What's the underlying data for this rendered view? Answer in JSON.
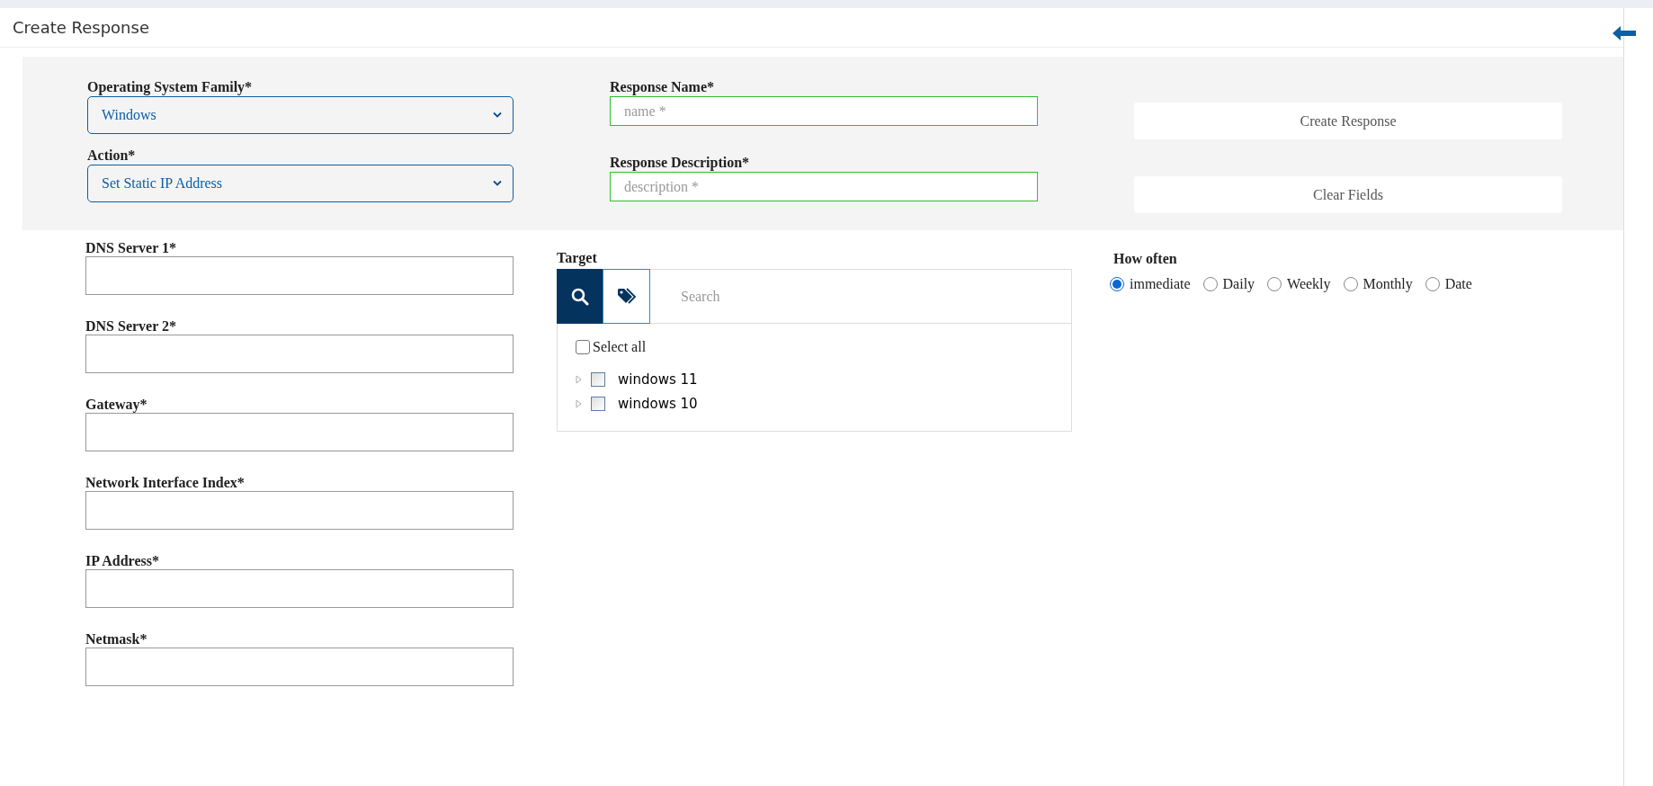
{
  "header": {
    "title": "Create Response"
  },
  "top_form": {
    "selects": [
      {
        "label": "Operating System Family*",
        "value": "Windows"
      },
      {
        "label": "Action*",
        "value": "Set Static IP Address"
      }
    ],
    "inputs": [
      {
        "label": "Response Name*",
        "placeholder": "name *"
      },
      {
        "label": "Response Description*",
        "placeholder": "description *"
      }
    ],
    "buttons": [
      "Create Response",
      "Clear Fields"
    ]
  },
  "fields": [
    {
      "label": "DNS Server 1*"
    },
    {
      "label": "DNS Server 2*"
    },
    {
      "label": "Gateway*"
    },
    {
      "label": "Network Interface Index*"
    },
    {
      "label": "IP Address*"
    },
    {
      "label": "Netmask*"
    }
  ],
  "target": {
    "label": "Target",
    "modes": [
      {
        "kind": "search",
        "selected": true
      },
      {
        "kind": "tag",
        "selected": false
      }
    ],
    "search": {
      "placeholder": "Search"
    },
    "select_all": {
      "label": "Select all",
      "checked": false
    },
    "tree": [
      {
        "label": "windows 11",
        "checked": false,
        "expanded": false
      },
      {
        "label": "windows 10",
        "checked": false,
        "expanded": false
      }
    ]
  },
  "how_often": {
    "label": "How often",
    "options": [
      {
        "label": "immediate",
        "selected": true
      },
      {
        "label": "Daily",
        "selected": false
      },
      {
        "label": "Weekly",
        "selected": false
      },
      {
        "label": "Monthly",
        "selected": false
      },
      {
        "label": "Date",
        "selected": false
      }
    ]
  }
}
